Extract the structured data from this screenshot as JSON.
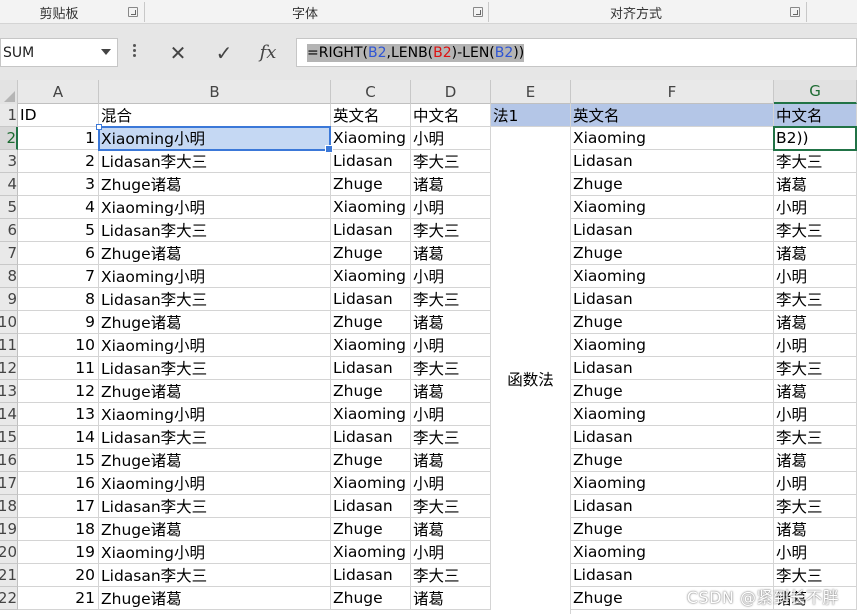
{
  "ribbon": {
    "groups": [
      "剪贴板",
      "字体",
      "对齐方式"
    ]
  },
  "formula_bar": {
    "name_box": "SUM",
    "cancel_icon": "✕",
    "confirm_icon": "✓",
    "fx_label": "fx",
    "formula_parts": [
      "=RIGHT(",
      "B2",
      ",LENB(",
      "B2",
      ")-LEN(",
      "B2",
      "))"
    ]
  },
  "columns": [
    "A",
    "B",
    "C",
    "D",
    "E",
    "F",
    "G"
  ],
  "active_column": "G",
  "active_row": "2",
  "header_row": {
    "row_number": "1",
    "A": "ID",
    "B": "混合",
    "C": "英文名",
    "D": "中文名",
    "E": "法1",
    "F": "英文名",
    "G": "中文名"
  },
  "merged_label": "函数法",
  "editing_cell": {
    "ref": "G2",
    "text": "B2))"
  },
  "rows": [
    {
      "n": "2",
      "id": "1",
      "mix": "Xiaoming小明",
      "en": "Xiaoming",
      "cn": "小明",
      "f": "Xiaoming",
      "g": "B2))"
    },
    {
      "n": "3",
      "id": "2",
      "mix": "Lidasan李大三",
      "en": "Lidasan",
      "cn": "李大三",
      "f": "Lidasan",
      "g": "李大三"
    },
    {
      "n": "4",
      "id": "3",
      "mix": "Zhuge诸葛",
      "en": "Zhuge",
      "cn": "诸葛",
      "f": "Zhuge",
      "g": "诸葛"
    },
    {
      "n": "5",
      "id": "4",
      "mix": "Xiaoming小明",
      "en": "Xiaoming",
      "cn": "小明",
      "f": "Xiaoming",
      "g": "小明"
    },
    {
      "n": "6",
      "id": "5",
      "mix": "Lidasan李大三",
      "en": "Lidasan",
      "cn": "李大三",
      "f": "Lidasan",
      "g": "李大三"
    },
    {
      "n": "7",
      "id": "6",
      "mix": "Zhuge诸葛",
      "en": "Zhuge",
      "cn": "诸葛",
      "f": "Zhuge",
      "g": "诸葛"
    },
    {
      "n": "8",
      "id": "7",
      "mix": "Xiaoming小明",
      "en": "Xiaoming",
      "cn": "小明",
      "f": "Xiaoming",
      "g": "小明"
    },
    {
      "n": "9",
      "id": "8",
      "mix": "Lidasan李大三",
      "en": "Lidasan",
      "cn": "李大三",
      "f": "Lidasan",
      "g": "李大三"
    },
    {
      "n": "10",
      "id": "9",
      "mix": "Zhuge诸葛",
      "en": "Zhuge",
      "cn": "诸葛",
      "f": "Zhuge",
      "g": "诸葛"
    },
    {
      "n": "11",
      "id": "10",
      "mix": "Xiaoming小明",
      "en": "Xiaoming",
      "cn": "小明",
      "f": "Xiaoming",
      "g": "小明"
    },
    {
      "n": "12",
      "id": "11",
      "mix": "Lidasan李大三",
      "en": "Lidasan",
      "cn": "李大三",
      "f": "Lidasan",
      "g": "李大三"
    },
    {
      "n": "13",
      "id": "12",
      "mix": "Zhuge诸葛",
      "en": "Zhuge",
      "cn": "诸葛",
      "f": "Zhuge",
      "g": "诸葛"
    },
    {
      "n": "14",
      "id": "13",
      "mix": "Xiaoming小明",
      "en": "Xiaoming",
      "cn": "小明",
      "f": "Xiaoming",
      "g": "小明"
    },
    {
      "n": "15",
      "id": "14",
      "mix": "Lidasan李大三",
      "en": "Lidasan",
      "cn": "李大三",
      "f": "Lidasan",
      "g": "李大三"
    },
    {
      "n": "16",
      "id": "15",
      "mix": "Zhuge诸葛",
      "en": "Zhuge",
      "cn": "诸葛",
      "f": "Zhuge",
      "g": "诸葛"
    },
    {
      "n": "17",
      "id": "16",
      "mix": "Xiaoming小明",
      "en": "Xiaoming",
      "cn": "小明",
      "f": "Xiaoming",
      "g": "小明"
    },
    {
      "n": "18",
      "id": "17",
      "mix": "Lidasan李大三",
      "en": "Lidasan",
      "cn": "李大三",
      "f": "Lidasan",
      "g": "李大三"
    },
    {
      "n": "19",
      "id": "18",
      "mix": "Zhuge诸葛",
      "en": "Zhuge",
      "cn": "诸葛",
      "f": "Zhuge",
      "g": "诸葛"
    },
    {
      "n": "20",
      "id": "19",
      "mix": "Xiaoming小明",
      "en": "Xiaoming",
      "cn": "小明",
      "f": "Xiaoming",
      "g": "小明"
    },
    {
      "n": "21",
      "id": "20",
      "mix": "Lidasan李大三",
      "en": "Lidasan",
      "cn": "李大三",
      "f": "Lidasan",
      "g": "李大三"
    },
    {
      "n": "22",
      "id": "21",
      "mix": "Zhuge诸葛",
      "en": "Zhuge",
      "cn": "诸葛",
      "f": "Zhuge",
      "g": "诸葛"
    }
  ],
  "watermark": "CSDN @紧到长不胖",
  "colors": {
    "header_fill": "#b4c6e7",
    "selection_blue": "#3b78d8",
    "active_green": "#217346",
    "ref_blue": "#2f55d4",
    "ref_red": "#dd1111"
  }
}
